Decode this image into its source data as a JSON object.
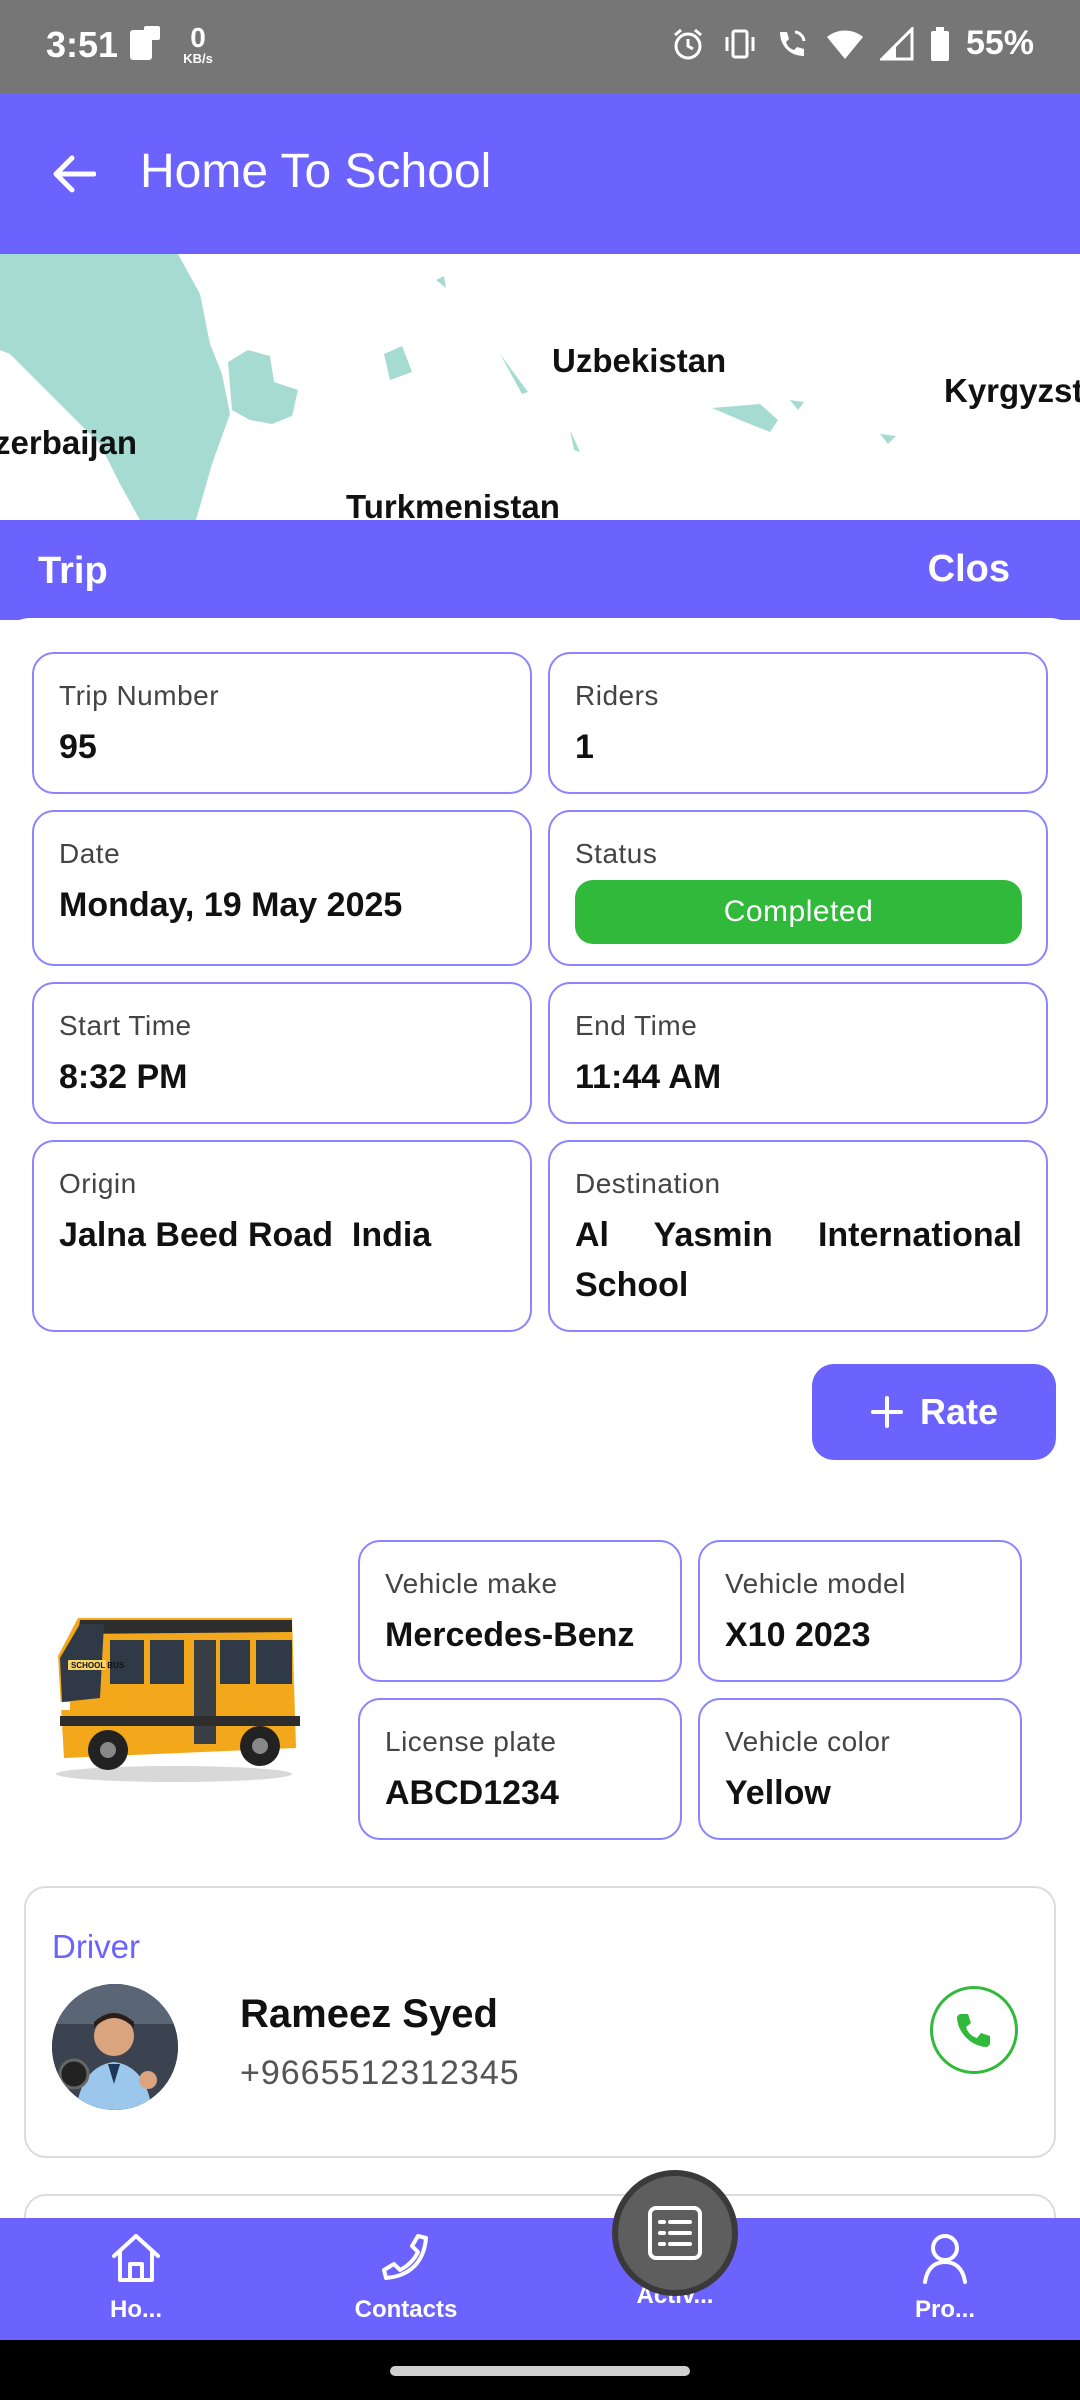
{
  "status_bar": {
    "time": "3:51",
    "data_rate_value": "0",
    "data_rate_unit": "KB/s",
    "battery": "55%",
    "icons": [
      "phone-card-icon",
      "alarm-icon",
      "vibrate-icon",
      "wifi-call-icon",
      "wifi-icon",
      "signal-icon",
      "battery-icon"
    ]
  },
  "app_bar": {
    "title": "Home To School",
    "back_icon": "arrow-left-icon"
  },
  "map": {
    "labels": [
      "Uzbekistan",
      "Kyrgyzst",
      "zerbaijan",
      "Turkmenistan"
    ],
    "water_color": "#a6dbd1"
  },
  "sheet": {
    "title": "Trip",
    "close_label": "Clos"
  },
  "trip": {
    "trip_number_label": "Trip Number",
    "trip_number": "95",
    "riders_label": "Riders",
    "riders": "1",
    "date_label": "Date",
    "date": "Monday, 19 May 2025",
    "status_label": "Status",
    "status": "Completed",
    "start_time_label": "Start Time",
    "start_time": "8:32 PM",
    "end_time_label": "End Time",
    "end_time": "11:44 AM",
    "origin_label": "Origin",
    "origin": "Jalna Beed Road  India",
    "destination_label": "Destination",
    "destination": "Al Yasmin International School"
  },
  "rate_button": {
    "label": "Rate",
    "icon": "plus-icon"
  },
  "vehicle": {
    "make_label": "Vehicle make",
    "make": "Mercedes-Benz",
    "model_label": "Vehicle model",
    "model": "X10 2023",
    "plate_label": "License plate",
    "plate": "ABCD1234",
    "color_label": "Vehicle color",
    "color": "Yellow",
    "image_text": "SCHOOL BUS"
  },
  "driver": {
    "section_label": "Driver",
    "name": "Rameez Syed",
    "phone": "+9665512312345"
  },
  "bottom_nav": {
    "items": [
      {
        "label": "Ho...",
        "icon": "home-icon"
      },
      {
        "label": "Contacts",
        "icon": "phone-icon"
      },
      {
        "label": "Activ...",
        "icon": "list-icon"
      },
      {
        "label": "Pro...",
        "icon": "person-icon"
      }
    ]
  },
  "colors": {
    "primary": "#6c63ff",
    "status_green": "#30b93a",
    "card_border": "#8a84ff"
  }
}
